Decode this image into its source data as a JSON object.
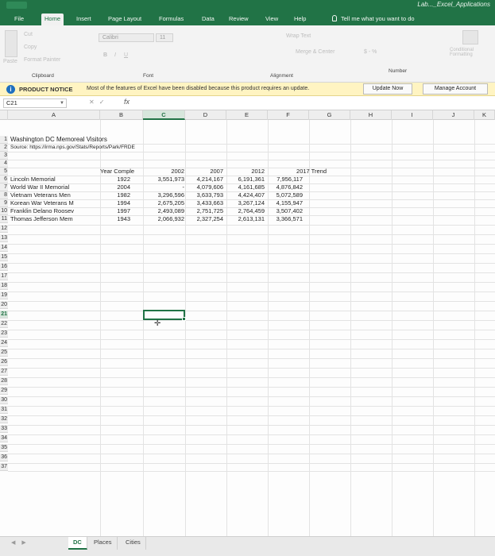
{
  "window": {
    "title": "Lab..._Excel_Applications",
    "accent": "#217346"
  },
  "tabs": [
    "File",
    "Home",
    "Insert",
    "Page Layout",
    "Formulas",
    "Data",
    "Review",
    "View",
    "Help"
  ],
  "active_tab": "Home",
  "tellme": "Tell me what you want to do",
  "ribbon": {
    "clipboard": {
      "label": "Clipboard",
      "cut": "Cut",
      "copy": "Copy",
      "format_painter": "Format Painter",
      "paste": "Paste"
    },
    "font": {
      "label": "Font",
      "name": "Calibri",
      "size": "11"
    },
    "alignment": {
      "label": "Alignment",
      "wrap": "Wrap Text",
      "merge": "Merge & Center"
    },
    "number": {
      "label": "Number",
      "currency": "$ - %"
    },
    "styles": {
      "conditional": "Conditional Formatting"
    }
  },
  "notice": {
    "title": "PRODUCT NOTICE",
    "message": "Most of the features of Excel have been disabled because this product requires an update.",
    "update_button": "Update Now",
    "manage_button": "Manage Account"
  },
  "formula_bar": {
    "name_box": "C21",
    "fx": "fx",
    "value": ""
  },
  "columns": [
    "A",
    "B",
    "C",
    "D",
    "E",
    "F",
    "G",
    "H",
    "I",
    "J",
    "K"
  ],
  "selected_column": "C",
  "rows": [
    "1",
    "2",
    "3",
    "4",
    "5",
    "6",
    "7",
    "8",
    "9",
    "10",
    "11",
    "12",
    "13",
    "14",
    "15",
    "16",
    "17",
    "18",
    "19",
    "20",
    "21",
    "22",
    "23",
    "24",
    "25",
    "26",
    "27",
    "28",
    "29",
    "30",
    "31",
    "32",
    "33",
    "34",
    "35",
    "36",
    "37"
  ],
  "selected_row": "21",
  "sheet": {
    "title": "Washington DC Memoreal Visitors",
    "source": "Source: https://irma.nps.gov/Stats/Reports/Park/FRDE",
    "header": {
      "year_complete": "Year Comple",
      "y2002": "2002",
      "y2007": "2007",
      "y2012": "2012",
      "trend": "2017 Trend"
    },
    "records": [
      {
        "name": "Lincoln Memorial",
        "year": "1922",
        "v2002": "3,551,973",
        "v2007": "4,214,167",
        "v2012": "6,191,361",
        "v2017": "7,956,117"
      },
      {
        "name": "World War II Memorial",
        "year": "2004",
        "v2002": "-",
        "v2007": "4,079,606",
        "v2012": "4,161,685",
        "v2017": "4,876,842"
      },
      {
        "name": "Vietnam Veterans Men",
        "year": "1982",
        "v2002": "3,296,596",
        "v2007": "3,633,793",
        "v2012": "4,424,407",
        "v2017": "5,072,589"
      },
      {
        "name": "Korean War Veterans M",
        "year": "1994",
        "v2002": "2,675,205",
        "v2007": "3,433,663",
        "v2012": "3,267,124",
        "v2017": "4,155,947"
      },
      {
        "name": "Franklin Delano Roosev",
        "year": "1997",
        "v2002": "2,493,089",
        "v2007": "2,751,725",
        "v2012": "2,764,459",
        "v2017": "3,507,402"
      },
      {
        "name": "Thomas Jefferson Mem",
        "year": "1943",
        "v2002": "2,066,932",
        "v2007": "2,327,254",
        "v2012": "2,613,131",
        "v2017": "3,366,571"
      }
    ]
  },
  "sheet_tabs": [
    "DC",
    "Places",
    "Cities"
  ],
  "active_sheet": "DC"
}
